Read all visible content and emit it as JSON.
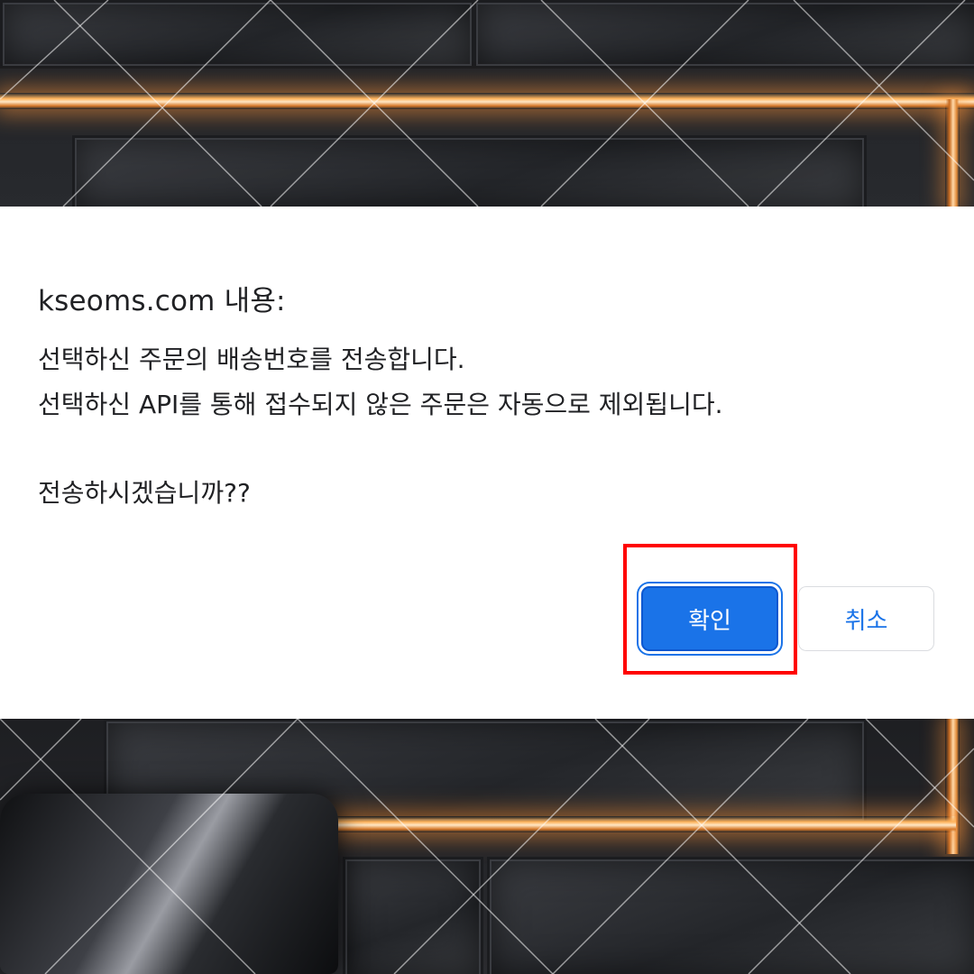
{
  "dialog": {
    "title": "kseoms.com 내용:",
    "message_lines": [
      "선택하신 주문의 배송번호를 전송합니다.",
      "선택하신 API를 통해 접수되지 않은 주문은 자동으로 제외됩니다.",
      "전송하시겠습니까??"
    ],
    "confirm_label": "확인",
    "cancel_label": "취소"
  },
  "colors": {
    "accent": "#1a73e8",
    "highlight": "#ff0000",
    "dialog_bg": "#ffffff"
  },
  "annotation": {
    "highlighted_element": "confirm-button"
  }
}
